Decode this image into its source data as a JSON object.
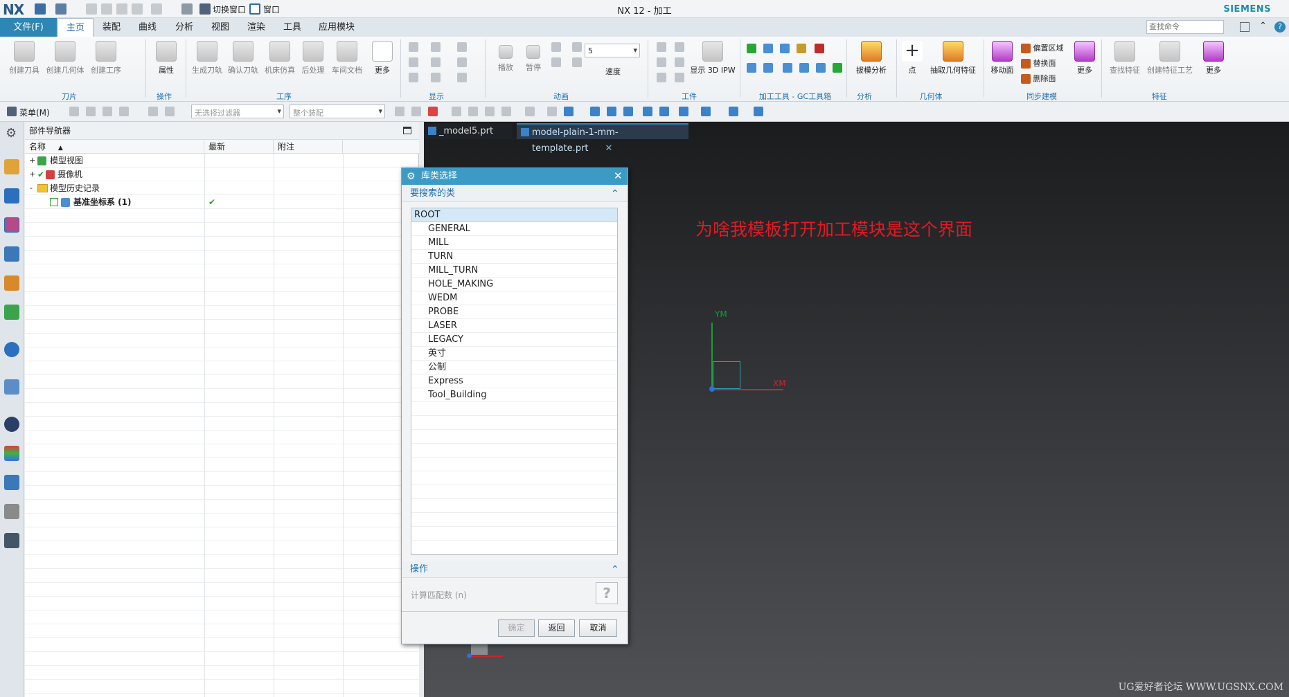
{
  "app": {
    "logo": "NX",
    "window_title": "NX 12 - 加工",
    "brand": "SIEMENS"
  },
  "quickaccess": {
    "switch_window": "切换窗口",
    "window": "窗口"
  },
  "menu": {
    "file": "文件(F)",
    "tabs": [
      "主页",
      "装配",
      "曲线",
      "分析",
      "视图",
      "渲染",
      "工具",
      "应用模块"
    ],
    "search_placeholder": "查找命令"
  },
  "ribbon": {
    "tool_group": {
      "buttons": [
        "创建刀具",
        "创建几何体",
        "创建工序"
      ],
      "label": "刀片"
    },
    "ops_group": {
      "buttons": [
        "属性"
      ],
      "label": "操作"
    },
    "proc_group": {
      "buttons": [
        "生成刀轨",
        "确认刀轨",
        "机床仿真",
        "后处理",
        "车间文档",
        "更多"
      ],
      "label": "工序"
    },
    "display_group": {
      "label": "显示"
    },
    "anim_group": {
      "buttons": [
        "播放",
        "暂停"
      ],
      "speed_value": "5",
      "speed_label": "速度",
      "label": "动画"
    },
    "workpiece_group": {
      "buttons": [
        "显示 3D IPW"
      ],
      "label": "工件"
    },
    "gc_group": {
      "label": "加工工具 - GC工具箱"
    },
    "analysis_group": {
      "buttons": [
        "拔模分析"
      ],
      "label": "分析"
    },
    "geometry_group": {
      "buttons": [
        "点",
        "抽取几何特征"
      ],
      "label": "几何体"
    },
    "sync_group": {
      "buttons": [
        "移动面",
        "偏置区域",
        "替换面",
        "删除面",
        "更多"
      ],
      "label": "同步建模"
    },
    "feature_group": {
      "buttons": [
        "查找特征",
        "创建特征工艺",
        "更多"
      ],
      "label": "特征"
    }
  },
  "toolbar2": {
    "menu": "菜单(M)",
    "filter": "无选择过滤器",
    "assembly": "整个装配"
  },
  "navigator": {
    "title": "部件导航器",
    "columns": [
      "名称",
      "最新",
      "附注"
    ],
    "rows": [
      {
        "name": "模型视图",
        "expander": "+",
        "latest": ""
      },
      {
        "name": "摄像机",
        "expander": "+",
        "latest": ""
      },
      {
        "name": "模型历史记录",
        "expander": "-",
        "latest": ""
      },
      {
        "name": "基准坐标系 (1)",
        "expander": "",
        "latest": "✔"
      }
    ]
  },
  "doc_tabs": [
    "_model5.prt",
    "model-plain-1-mm-template.prt"
  ],
  "dialog": {
    "title": "库类选择",
    "section_search": "要搜索的类",
    "classes": [
      "ROOT",
      "GENERAL",
      "MILL",
      "TURN",
      "MILL_TURN",
      "HOLE_MAKING",
      "WEDM",
      "PROBE",
      "LASER",
      "LEGACY",
      "英寸",
      "公制",
      "Express",
      "Tool_Building"
    ],
    "section_ops": "操作",
    "count_label": "计算匹配数 (n)",
    "help": "?",
    "buttons": {
      "ok": "确定",
      "back": "返回",
      "cancel": "取消"
    }
  },
  "viewport": {
    "annotation": "为啥我模板打开加工模块是这个界面",
    "axis_y": "YM",
    "axis_x": "XM",
    "watermark": "UG爱好者论坛 WWW.UGSNX.COM"
  },
  "colors": {
    "accent": "#2d86b3",
    "dialog_title": "#3c9bc4",
    "annotation": "#e21a23"
  }
}
